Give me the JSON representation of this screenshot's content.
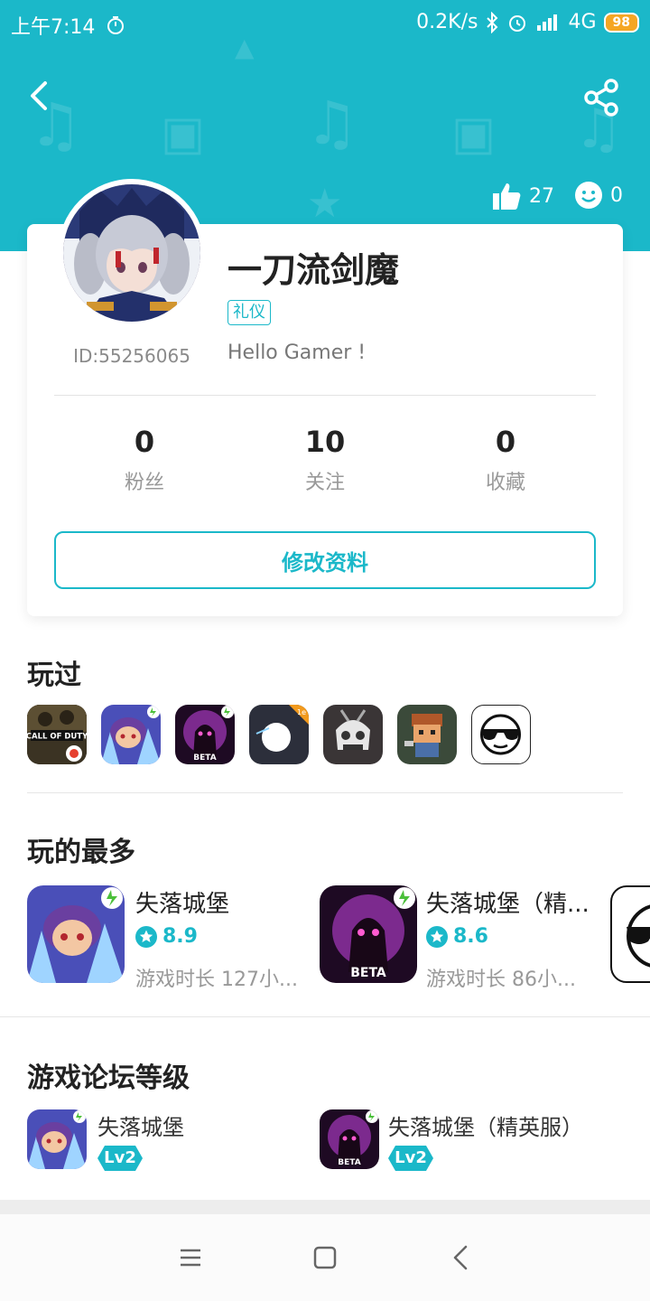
{
  "status_bar": {
    "time": "上午7:14",
    "net_speed": "0.2K/s",
    "network": "4G",
    "battery": "98",
    "icons": [
      "timer-icon",
      "bluetooth-icon",
      "alarm-icon",
      "signal-icon"
    ]
  },
  "header": {
    "bg_color": "#1bb8c9",
    "likes": "27",
    "smiles": "0",
    "icons": [
      "back-icon",
      "share-icon",
      "thumbs-up-icon",
      "smile-icon"
    ]
  },
  "profile": {
    "username": "一刀流剑魔",
    "tag": "礼仪",
    "user_id": "ID:55256065",
    "bio": "Hello Gamer !",
    "stats": [
      {
        "value": "0",
        "label": "粉丝"
      },
      {
        "value": "10",
        "label": "关注"
      },
      {
        "value": "0",
        "label": "收藏"
      }
    ],
    "edit_button": "修改资料"
  },
  "played": {
    "title": "玩过",
    "games": [
      "call-of-duty-icon",
      "lost-castle-icon",
      "lost-castle-beta-icon",
      "white-ball-game-icon",
      "skull-knight-game-icon",
      "pixel-hero-game-icon",
      "sunglasses-face-icon"
    ],
    "cod_label": "CALL OF DUTY",
    "beta_label": "BETA",
    "badge_1e": "1e"
  },
  "most_played": {
    "title": "玩的最多",
    "items": [
      {
        "name": "失落城堡",
        "score": "8.9",
        "time": "游戏时长 127小..."
      },
      {
        "name": "失落城堡（精...",
        "score": "8.6",
        "time": "游戏时长 86小..."
      }
    ]
  },
  "forum_level": {
    "title": "游戏论坛等级",
    "items": [
      {
        "name": "失落城堡",
        "level": "Lv2"
      },
      {
        "name": "失落城堡（精英服）",
        "level": "Lv2"
      }
    ]
  },
  "nav": {
    "icons": [
      "menu-icon",
      "home-icon",
      "back-nav-icon"
    ]
  }
}
